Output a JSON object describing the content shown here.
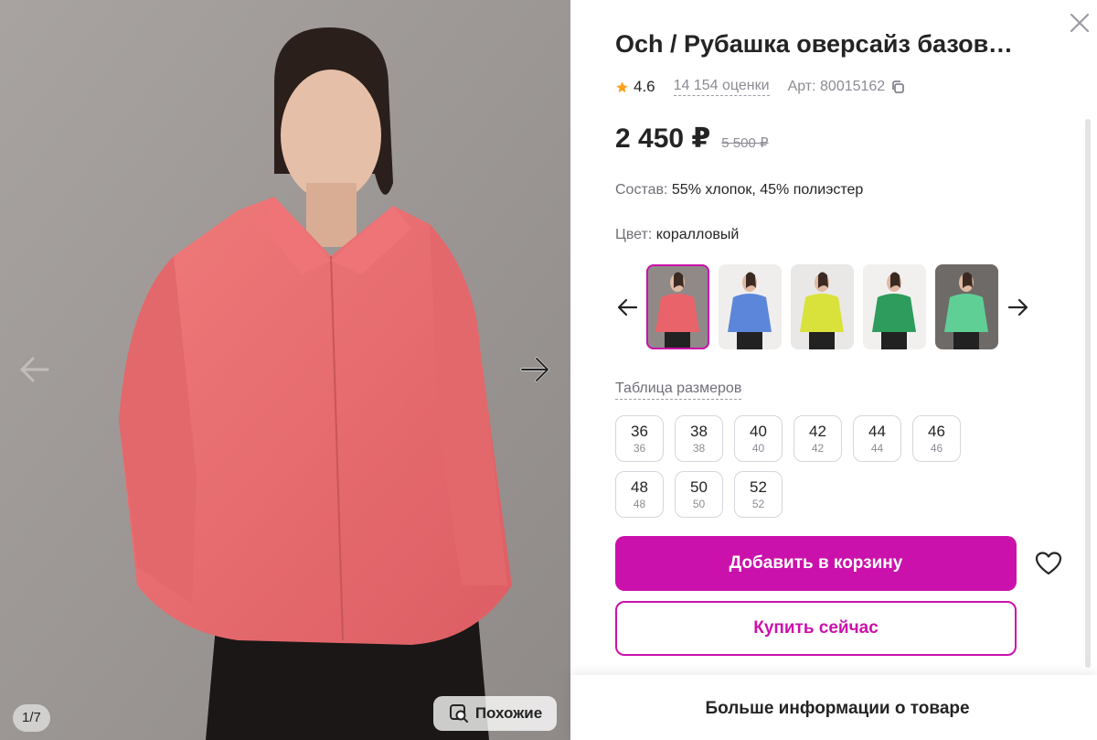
{
  "gallery": {
    "counter": "1/7",
    "similar_label": "Похожие"
  },
  "product": {
    "title": "Och / Рубашка оверсайз базовая из хлопка",
    "rating": "4.6",
    "reviews": "14 154 оценки",
    "article": "Арт: 80015162",
    "price": "2 450 ₽",
    "old_price": "5 500 ₽",
    "composition_label": "Состав:",
    "composition_value": "55% хлопок, 45% полиэстер",
    "color_label": "Цвет:",
    "color_value": "коралловый"
  },
  "color_thumbs": [
    {
      "name": "coral",
      "color": "#e8646a",
      "selected": true
    },
    {
      "name": "blue",
      "color": "#5b86d9",
      "selected": false
    },
    {
      "name": "lime",
      "color": "#d9e23a",
      "selected": false
    },
    {
      "name": "green",
      "color": "#2d9c5c",
      "selected": false
    },
    {
      "name": "mint",
      "color": "#5fcf96",
      "selected": false
    }
  ],
  "sizes": {
    "table_link": "Таблица размеров",
    "items": [
      {
        "main": "36",
        "sub": "36"
      },
      {
        "main": "38",
        "sub": "38"
      },
      {
        "main": "40",
        "sub": "40"
      },
      {
        "main": "42",
        "sub": "42"
      },
      {
        "main": "44",
        "sub": "44"
      },
      {
        "main": "46",
        "sub": "46"
      },
      {
        "main": "48",
        "sub": "48"
      },
      {
        "main": "50",
        "sub": "50"
      },
      {
        "main": "52",
        "sub": "52"
      }
    ]
  },
  "actions": {
    "add_to_cart": "Добавить в корзину",
    "buy_now": "Купить сейчас",
    "more_info": "Больше информации о товаре"
  },
  "colors": {
    "accent": "#cb11ab",
    "star": "#ff9f1a"
  }
}
